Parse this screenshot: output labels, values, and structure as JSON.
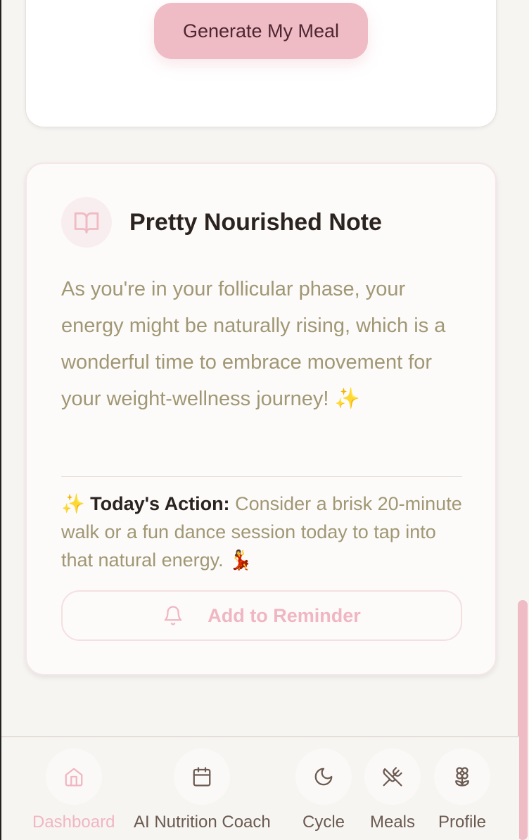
{
  "meal_card": {
    "generate_label": "Generate My Meal"
  },
  "note": {
    "title": "Pretty Nourished Note",
    "body": "As you're in your follicular phase, your energy might be naturally rising, which is a wonderful time to embrace movement for your weight-wellness journey! ✨",
    "action_prefix": "✨ ",
    "action_label": "Today's Action:",
    "action_text": " Consider a brisk 20-minute walk or a fun dance session today to tap into that natural energy. 💃",
    "reminder_label": "Add to Reminder",
    "icon": "book-open-icon"
  },
  "nav": {
    "items": [
      {
        "label": "Dashboard",
        "icon": "home-icon",
        "active": true
      },
      {
        "label": "AI Nutrition Coach",
        "icon": "calendar-icon",
        "active": false
      },
      {
        "label": "Cycle",
        "icon": "moon-icon",
        "active": false
      },
      {
        "label": "Meals",
        "icon": "utensils-crossed-icon",
        "active": false
      },
      {
        "label": "Profile",
        "icon": "flower-icon",
        "active": false
      }
    ]
  },
  "colors": {
    "accent_pink": "#efbbc4",
    "body_text": "#a19774",
    "title_text": "#2b2320",
    "nav_text": "#6b5a50"
  }
}
